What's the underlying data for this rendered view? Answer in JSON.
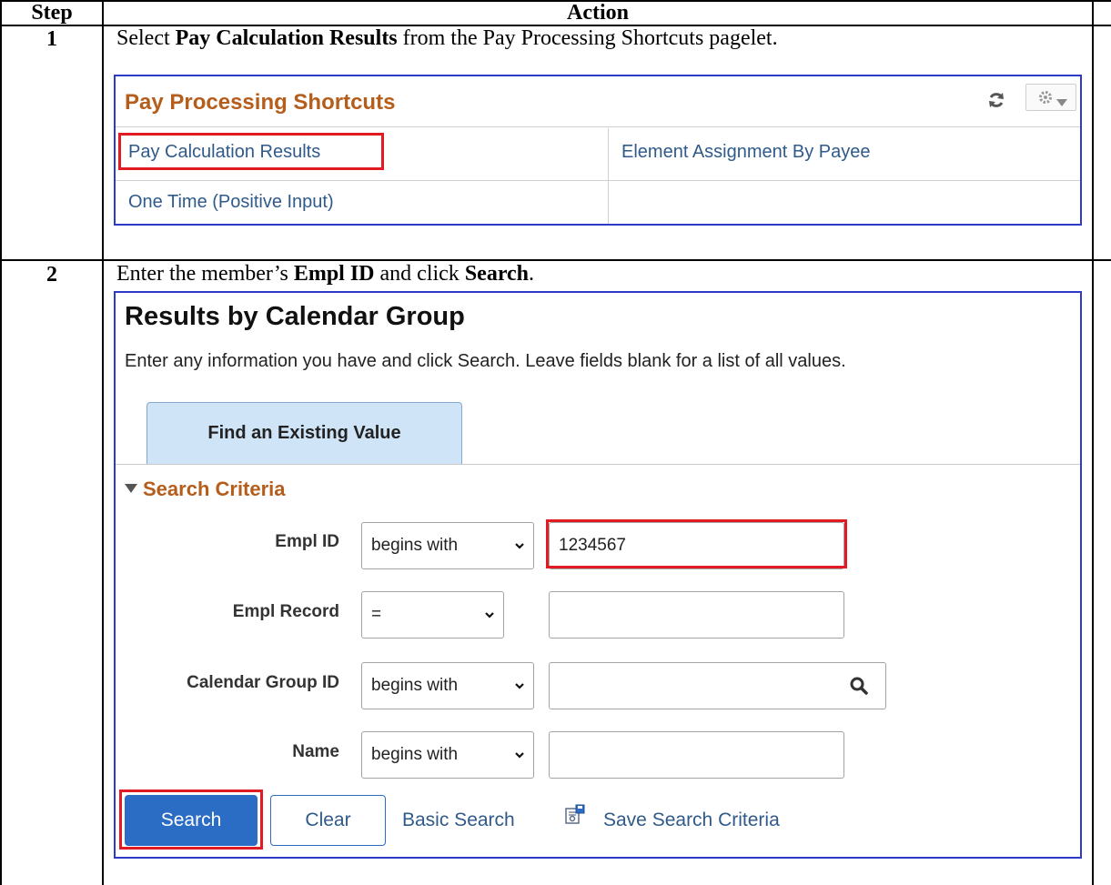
{
  "table": {
    "header_step": "Step",
    "header_action": "Action"
  },
  "row1": {
    "step": "1",
    "instruction_pre": "Select ",
    "instruction_bold": "Pay Calculation Results",
    "instruction_post": " from the Pay Processing Shortcuts pagelet.",
    "pagelet": {
      "title": "Pay Processing Shortcuts",
      "links": [
        "Pay Calculation Results",
        "Element Assignment By Payee",
        "One Time (Positive Input)"
      ],
      "icons": [
        "refresh-icon",
        "gear-icon"
      ]
    }
  },
  "row2": {
    "step": "2",
    "instruction_pre": "Enter the member’s ",
    "instruction_bold1": "Empl ID",
    "instruction_mid": " and click ",
    "instruction_bold2": "Search",
    "instruction_post": ".",
    "search": {
      "title": "Results by Calendar Group",
      "description": "Enter any information you have and click Search. Leave fields blank for a list of all values.",
      "tab_label": "Find an Existing Value",
      "section_label": "Search Criteria",
      "fields": [
        {
          "label": "Empl ID",
          "operator": "begins with",
          "value": "1234567"
        },
        {
          "label": "Empl Record",
          "operator": "=",
          "value": ""
        },
        {
          "label": "Calendar Group ID",
          "operator": "begins with",
          "value": ""
        },
        {
          "label": "Name",
          "operator": "begins with",
          "value": ""
        }
      ],
      "buttons": {
        "search": "Search",
        "clear": "Clear",
        "basic_search": "Basic Search",
        "save_criteria": "Save Search Criteria"
      }
    }
  },
  "colors": {
    "panel_border": "#2e3ac8",
    "highlight": "#e01b24",
    "pagelet_title": "#b55d1b",
    "link": "#2f5a8a",
    "tab_bg": "#cfe4f7",
    "search_button": "#2b6cc4"
  }
}
